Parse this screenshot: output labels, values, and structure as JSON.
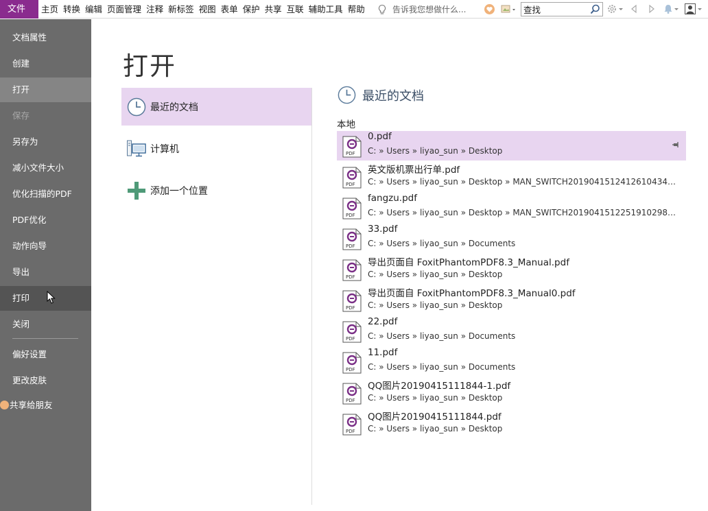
{
  "menubar": {
    "file_tab": "文件",
    "menus": [
      "主页",
      "转换",
      "编辑",
      "页面管理",
      "注释",
      "新标签",
      "视图",
      "表单",
      "保护",
      "共享",
      "互联",
      "辅助工具",
      "帮助"
    ],
    "tell_me": "告诉我您想做什么...",
    "search_value": "查找"
  },
  "sidebar": {
    "items": [
      {
        "label": "文档属性",
        "state": "normal"
      },
      {
        "label": "创建",
        "state": "normal"
      },
      {
        "label": "打开",
        "state": "active"
      },
      {
        "label": "保存",
        "state": "disabled"
      },
      {
        "label": "另存为",
        "state": "normal"
      },
      {
        "label": "减小文件大小",
        "state": "normal"
      },
      {
        "label": "优化扫描的PDF",
        "state": "normal"
      },
      {
        "label": "PDF优化",
        "state": "normal"
      },
      {
        "label": "动作向导",
        "state": "normal"
      },
      {
        "label": "导出",
        "state": "normal"
      },
      {
        "label": "打印",
        "state": "hover"
      },
      {
        "label": "关闭",
        "state": "normal"
      },
      {
        "label": "偏好设置",
        "state": "normal"
      },
      {
        "label": "更改皮肤",
        "state": "normal"
      },
      {
        "label": "共享给朋友",
        "state": "normal"
      }
    ]
  },
  "main": {
    "title": "打开",
    "open_options": [
      {
        "label": "最近的文档",
        "icon": "clock-icon",
        "selected": true
      },
      {
        "label": "计算机",
        "icon": "computer-icon",
        "selected": false
      },
      {
        "label": "添加一个位置",
        "icon": "plus-icon",
        "selected": false
      }
    ],
    "recent_header": "最近的文档",
    "local_label": "本地",
    "files": [
      {
        "name": "0.pdf",
        "path": "C: » Users » liyao_sun » Desktop",
        "selected": true
      },
      {
        "name": "英文版机票出行单.pdf",
        "path": "C: » Users » liyao_sun » Desktop » MAN_SWITCH201904151241261043461...",
        "selected": false
      },
      {
        "name": "fangzu.pdf",
        "path": "C: » Users » liyao_sun » Desktop » MAN_SWITCH201904151225191029802...",
        "selected": false
      },
      {
        "name": "33.pdf",
        "path": "C: » Users » liyao_sun » Documents",
        "selected": false
      },
      {
        "name": "导出页面自 FoxitPhantomPDF8.3_Manual.pdf",
        "path": "C: » Users » liyao_sun » Desktop",
        "selected": false
      },
      {
        "name": "导出页面自 FoxitPhantomPDF8.3_Manual0.pdf",
        "path": "C: » Users » liyao_sun » Desktop",
        "selected": false
      },
      {
        "name": "22.pdf",
        "path": "C: » Users » liyao_sun » Documents",
        "selected": false
      },
      {
        "name": "11.pdf",
        "path": "C: » Users » liyao_sun » Documents",
        "selected": false
      },
      {
        "name": "QQ图片20190415111844-1.pdf",
        "path": "C: » Users » liyao_sun » Desktop",
        "selected": false
      },
      {
        "name": "QQ图片20190415111844.pdf",
        "path": "C: » Users » liyao_sun » Desktop",
        "selected": false
      }
    ]
  },
  "colors": {
    "accent": "#8a2b8e",
    "selection": "#e8d5f0",
    "sidebar_bg": "#6b6b6b",
    "pdf_icon": "#7a2f86"
  }
}
